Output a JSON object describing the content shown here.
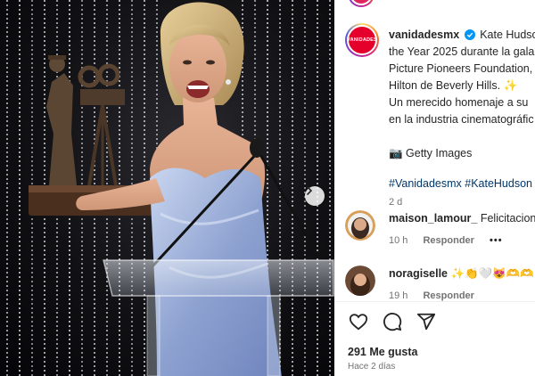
{
  "post": {
    "author": "vanidadesmx",
    "author_logo_text": "VANIDADES",
    "caption_lines": [
      "Kate Hudson",
      "the Year 2025 durante la gala",
      "Picture Pioneers Foundation,",
      "Hilton de Beverly Hills. ✨",
      "Un merecido homenaje a su",
      "en la industria cinematográfic"
    ],
    "credit": "📷 Getty Images",
    "hashtags": "#Vanidadesmx #KateHudson",
    "posted": "2 d"
  },
  "comments": [
    {
      "user": "maison_lamour_",
      "text": "Felicitaciones",
      "time": "10 h",
      "reply_label": "Responder",
      "more": "•••"
    },
    {
      "user": "noragiselle",
      "text": "✨👏🤍😻🫶🫶",
      "time": "19 h",
      "reply_label": "Responder"
    }
  ],
  "actions": {
    "icons": [
      "heart-icon",
      "comment-icon",
      "share-icon"
    ]
  },
  "likes_label": "291 Me gusta",
  "time_ago": "Hace 2 días",
  "colors": {
    "link": "#00376b",
    "muted": "#737373",
    "text": "#262626",
    "verified": "#0095f6",
    "brand_red": "#e4002b"
  }
}
